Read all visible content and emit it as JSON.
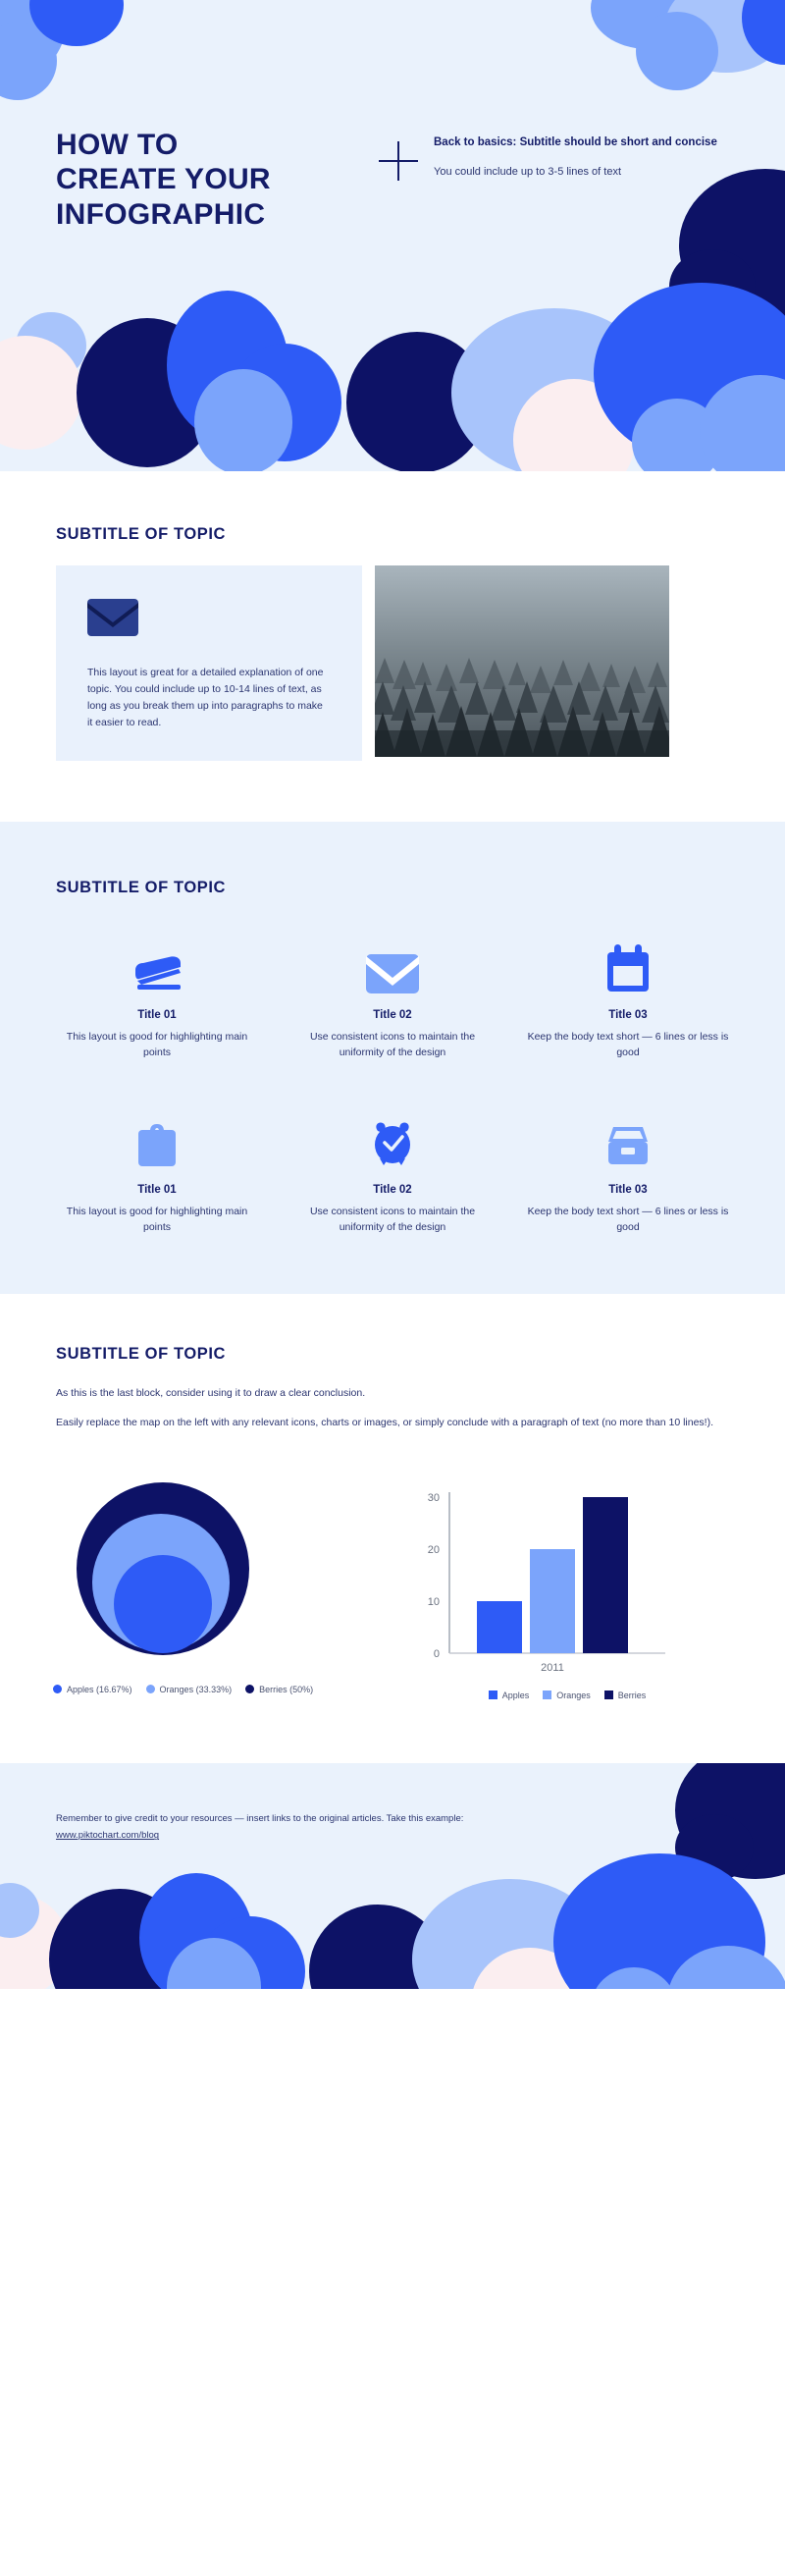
{
  "header": {
    "title": "HOW TO\nCREATE YOUR\nINFOGRAPHIC",
    "title_line1": "HOW TO",
    "title_line2": "CREATE YOUR",
    "title_line3": "INFOGRAPHIC",
    "divider_icon": "plus-icon",
    "subtitle_bold": "Back to basics: Subtitle should be short and concise",
    "subtitle_body": "You could include up to 3-5 lines of text"
  },
  "section1": {
    "title": "SUBTITLE OF TOPIC",
    "card_icon": "envelope-icon",
    "card_text": "This layout is great for a detailed explanation of one topic. You could include up to 10-14 lines of text, as long as you break them up into paragraphs to make it easier to read.",
    "photo_alt": "foggy-forest-photo"
  },
  "section2": {
    "title": "SUBTITLE OF TOPIC",
    "items": [
      {
        "icon": "stapler-icon",
        "title": "Title 01",
        "desc": "This layout is good for highlighting main points"
      },
      {
        "icon": "envelope-icon",
        "title": "Title 02",
        "desc": "Use consistent icons to maintain the uniformity of the design"
      },
      {
        "icon": "calendar-icon",
        "title": "Title 03",
        "desc": "Keep the body text short — 6 lines or less is good"
      },
      {
        "icon": "briefcase-icon",
        "title": "Title 01",
        "desc": "This layout is good for highlighting main points"
      },
      {
        "icon": "alarm-clock-icon",
        "title": "Title 02",
        "desc": "Use consistent icons to maintain the uniformity of the design"
      },
      {
        "icon": "file-box-icon",
        "title": "Title 03",
        "desc": "Keep the body text short — 6 lines or less is good"
      }
    ]
  },
  "section3": {
    "title": "SUBTITLE OF TOPIC",
    "paragraph1": "As this is the last block, consider using it to draw a clear conclusion.",
    "paragraph2": "Easily replace the map on the left with any relevant icons, charts or images, or simply conclude with a paragraph of text (no more than 10 lines!)."
  },
  "footer": {
    "text": "Remember to give credit to your resources — insert links to the original articles. Take this example:",
    "link": "www.piktochart.com/blog"
  },
  "colors": {
    "navy": "#0d1266",
    "royal_blue": "#2e5bf6",
    "light_blue": "#7ba4fb",
    "pale_blue": "#a8c4fb",
    "blush": "#fbeef0",
    "bg_tint": "#eaf2fc",
    "card_bg": "#e9f1fc",
    "text_navy": "#141c68",
    "body_text": "#2b3570"
  },
  "chart_data": [
    {
      "type": "pie",
      "render": "nested-bubbles",
      "title": "",
      "labels": [
        "Apples",
        "Oranges",
        "Berries"
      ],
      "values": [
        16.67,
        33.33,
        50
      ],
      "legend": [
        "Apples (16.67%)",
        "Oranges (33.33%)",
        "Berries (50%)"
      ],
      "colors": [
        "#2e5bf6",
        "#7ba4fb",
        "#0d1266"
      ],
      "legend_position": "bottom"
    },
    {
      "type": "bar",
      "title": "",
      "categories": [
        "2011"
      ],
      "xlabel": "",
      "ylabel": "",
      "ylim": [
        0,
        30
      ],
      "yticks": [
        0,
        10,
        20,
        30
      ],
      "grid": false,
      "legend_position": "bottom",
      "series": [
        {
          "name": "Apples",
          "values": [
            10
          ],
          "color": "#2e5bf6"
        },
        {
          "name": "Oranges",
          "values": [
            20
          ],
          "color": "#7ba4fb"
        },
        {
          "name": "Berries",
          "values": [
            30
          ],
          "color": "#0d1266"
        }
      ]
    }
  ]
}
